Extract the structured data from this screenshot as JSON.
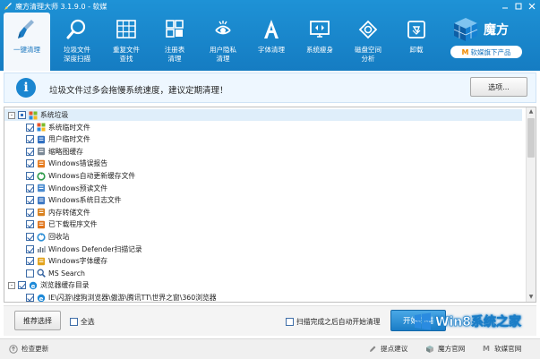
{
  "window": {
    "title": "魔方清理大师 3.1.9.0 - 软媒",
    "controls": [
      "minimize",
      "restore",
      "close"
    ],
    "accent_color": "#1a83cc"
  },
  "toolbar": {
    "items": [
      {
        "label": "一键清理",
        "icon": "broom-icon",
        "active": true
      },
      {
        "label": "垃圾文件\n深度扫描",
        "icon": "magnifier-icon"
      },
      {
        "label": "重复文件\n查找",
        "icon": "grid-icon"
      },
      {
        "label": "注册表\n清理",
        "icon": "registry-icon"
      },
      {
        "label": "用户隐私\n清理",
        "icon": "privacy-icon"
      },
      {
        "label": "字体清理",
        "icon": "font-icon"
      },
      {
        "label": "系统瘦身",
        "icon": "monitor-icon"
      },
      {
        "label": "磁盘空间\n分析",
        "icon": "disk-icon"
      },
      {
        "label": "卸载",
        "icon": "recycle-bin-icon"
      }
    ]
  },
  "brand": {
    "name": "魔方",
    "product_pill": "软媒旗下产品",
    "pill_mark": "M"
  },
  "info_bar": {
    "message": "垃圾文件过多会拖慢系统速度，建议定期清理！",
    "options_label": "选项..."
  },
  "tree": {
    "rows": [
      {
        "label": "系统垃圾",
        "level": 0,
        "expander": "-",
        "check": "partial",
        "icon": "windows-icon",
        "color": "#2a7fd4"
      },
      {
        "label": "系统临时文件",
        "level": 1,
        "check": "checked",
        "icon": "windows-flag-icon",
        "color": "#e8892a"
      },
      {
        "label": "用户临时文件",
        "level": 1,
        "check": "checked",
        "icon": "user-files-icon",
        "color": "#2f6fc0"
      },
      {
        "label": "缩略图缓存",
        "level": 1,
        "check": "checked",
        "icon": "thumbnail-icon",
        "color": "#7a8896"
      },
      {
        "label": "Windows错误报告",
        "level": 1,
        "check": "checked",
        "icon": "error-report-icon",
        "color": "#e67b1e"
      },
      {
        "label": "Windows自动更新缓存文件",
        "level": 1,
        "check": "checked",
        "icon": "update-icon",
        "color": "#2e9a4a"
      },
      {
        "label": "Windows预读文件",
        "level": 1,
        "check": "checked",
        "icon": "prefetch-icon",
        "color": "#4a8bd0"
      },
      {
        "label": "Windows系统日志文件",
        "level": 1,
        "check": "checked",
        "icon": "log-icon",
        "color": "#3d78c4"
      },
      {
        "label": "内存转储文件",
        "level": 1,
        "check": "checked",
        "icon": "memory-dump-icon",
        "color": "#d8801e"
      },
      {
        "label": "已下载程序文件",
        "level": 1,
        "check": "checked",
        "icon": "download-icon",
        "color": "#e0741a"
      },
      {
        "label": "回收站",
        "level": 1,
        "check": "checked",
        "icon": "recycle-icon",
        "color": "#2d8fd6"
      },
      {
        "label": "Windows Defender扫描记录",
        "level": 1,
        "check": "checked",
        "icon": "defender-icon",
        "color": "#6b7784"
      },
      {
        "label": "Windows字体缓存",
        "level": 1,
        "check": "checked",
        "icon": "font-cache-icon",
        "color": "#e2a21a"
      },
      {
        "label": "MS Search",
        "level": 1,
        "check": "unchecked",
        "icon": "search-icon",
        "color": "#2f5f9e"
      },
      {
        "label": "浏览器缓存目录",
        "level": 0,
        "expander": "-",
        "check": "checked",
        "icon": "ie-icon",
        "color": "#1f8ad8"
      },
      {
        "label": "IE\\闪游\\搜狗浏览器\\傲游\\腾讯TT\\世界之窗\\360浏览器",
        "level": 1,
        "check": "checked",
        "icon": "ie-icon",
        "color": "#1f8ad8"
      }
    ]
  },
  "actions": {
    "recommend_label": "推荐选择",
    "select_all_label": "全选",
    "auto_clean_label": "扫描完成之后自动开始清理",
    "start_label": "开始扫描"
  },
  "watermark": {
    "text": "Win8系统之家"
  },
  "status": {
    "check_update": "检查更新",
    "suggestion": "提点建议",
    "official_site": "魔方官网",
    "ruanmei_site": "软媒官网"
  }
}
